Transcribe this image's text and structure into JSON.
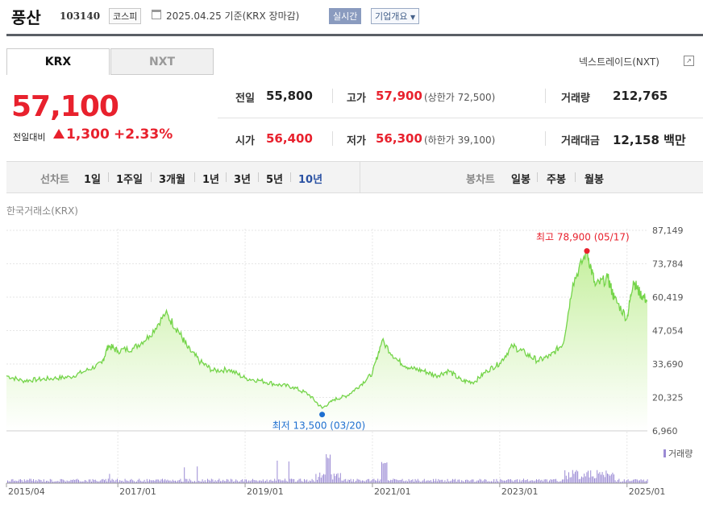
{
  "header": {
    "title": "풍산",
    "code": "103140",
    "market": "코스피",
    "date": "2025.04.25",
    "basis": "기준(KRX 장마감)",
    "realtime": "실시간",
    "corp_overview": "기업개요"
  },
  "tabs": [
    "KRX",
    "NXT"
  ],
  "nxt_link": "넥스트레이드(NXT)",
  "quote": {
    "price": "57,100",
    "prev_label": "전일대비",
    "change": "1,300",
    "change_pct": "+2.33%",
    "prev_close_label": "전일",
    "prev_close": "55,800",
    "high_label": "고가",
    "high": "57,900",
    "upper_limit": "(상한가 72,500)",
    "volume_label": "거래량",
    "volume": "212,765",
    "open_label": "시가",
    "open": "56,400",
    "low_label": "저가",
    "low": "56,300",
    "lower_limit": "(하한가 39,100)",
    "amount_label": "거래대금",
    "amount": "12,158",
    "amount_unit": "백만"
  },
  "periods": {
    "line_label": "선차트",
    "line_items": [
      "1일",
      "1주일",
      "3개월",
      "1년",
      "3년",
      "5년",
      "10년"
    ],
    "selected": "10년",
    "candle_label": "봉차트",
    "candle_items": [
      "일봉",
      "주봉",
      "월봉"
    ]
  },
  "source": "한국거래소(KRX)",
  "colors": {
    "up": "#e8212d",
    "line": "#74d449",
    "fill_top": "#c4ef9c",
    "volume": "#9b8ad4",
    "low_marker": "#1e6fd0"
  },
  "chart_data": {
    "type": "area",
    "y_ticks": [
      "87,149",
      "73,784",
      "60,419",
      "47,054",
      "33,690",
      "20,325",
      "6,960"
    ],
    "ylim": [
      6960,
      87149
    ],
    "x_ticks": [
      "2015/04",
      "2017/01",
      "2019/01",
      "2021/01",
      "2023/01",
      "2025/01"
    ],
    "x_tick_years": [
      2015.25,
      2017.0,
      2019.0,
      2021.0,
      2023.0,
      2025.0
    ],
    "xlim": [
      2015.25,
      2025.32
    ],
    "max_label": "최고 78,900 (05/17)",
    "min_label": "최저 13,500 (03/20)",
    "max_point": [
      2024.37,
      78900
    ],
    "min_point": [
      2020.21,
      13500
    ],
    "volume_label": "거래량",
    "series": [
      {
        "x": [
          2015.25,
          2015.5,
          2015.75,
          2016.0,
          2016.25,
          2016.5,
          2016.75,
          2016.85,
          2017.0,
          2017.25,
          2017.5,
          2017.75,
          2017.95,
          2018.1,
          2018.3,
          2018.5,
          2018.75,
          2019.0,
          2019.25,
          2019.5,
          2019.75,
          2020.0,
          2020.21,
          2020.4,
          2020.6,
          2020.8,
          2021.0,
          2021.15,
          2021.4,
          2021.6,
          2021.8,
          2022.0,
          2022.2,
          2022.4,
          2022.6,
          2022.8,
          2023.0,
          2023.2,
          2023.4,
          2023.6,
          2023.8,
          2024.0,
          2024.15,
          2024.37,
          2024.5,
          2024.7,
          2024.8,
          2025.0,
          2025.1,
          2025.2,
          2025.32
        ],
        "y": [
          29000,
          27000,
          27500,
          28000,
          28500,
          31000,
          34000,
          41000,
          39000,
          40000,
          45000,
          54000,
          47000,
          40000,
          34500,
          31000,
          31500,
          28000,
          27000,
          25500,
          24500,
          21500,
          16000,
          19500,
          21000,
          25000,
          30000,
          43000,
          35000,
          32000,
          31000,
          29000,
          31000,
          27000,
          26500,
          31000,
          34000,
          41000,
          38000,
          35000,
          37000,
          42000,
          66000,
          78900,
          65000,
          68000,
          60000,
          52000,
          67000,
          62000,
          59000
        ]
      }
    ]
  }
}
